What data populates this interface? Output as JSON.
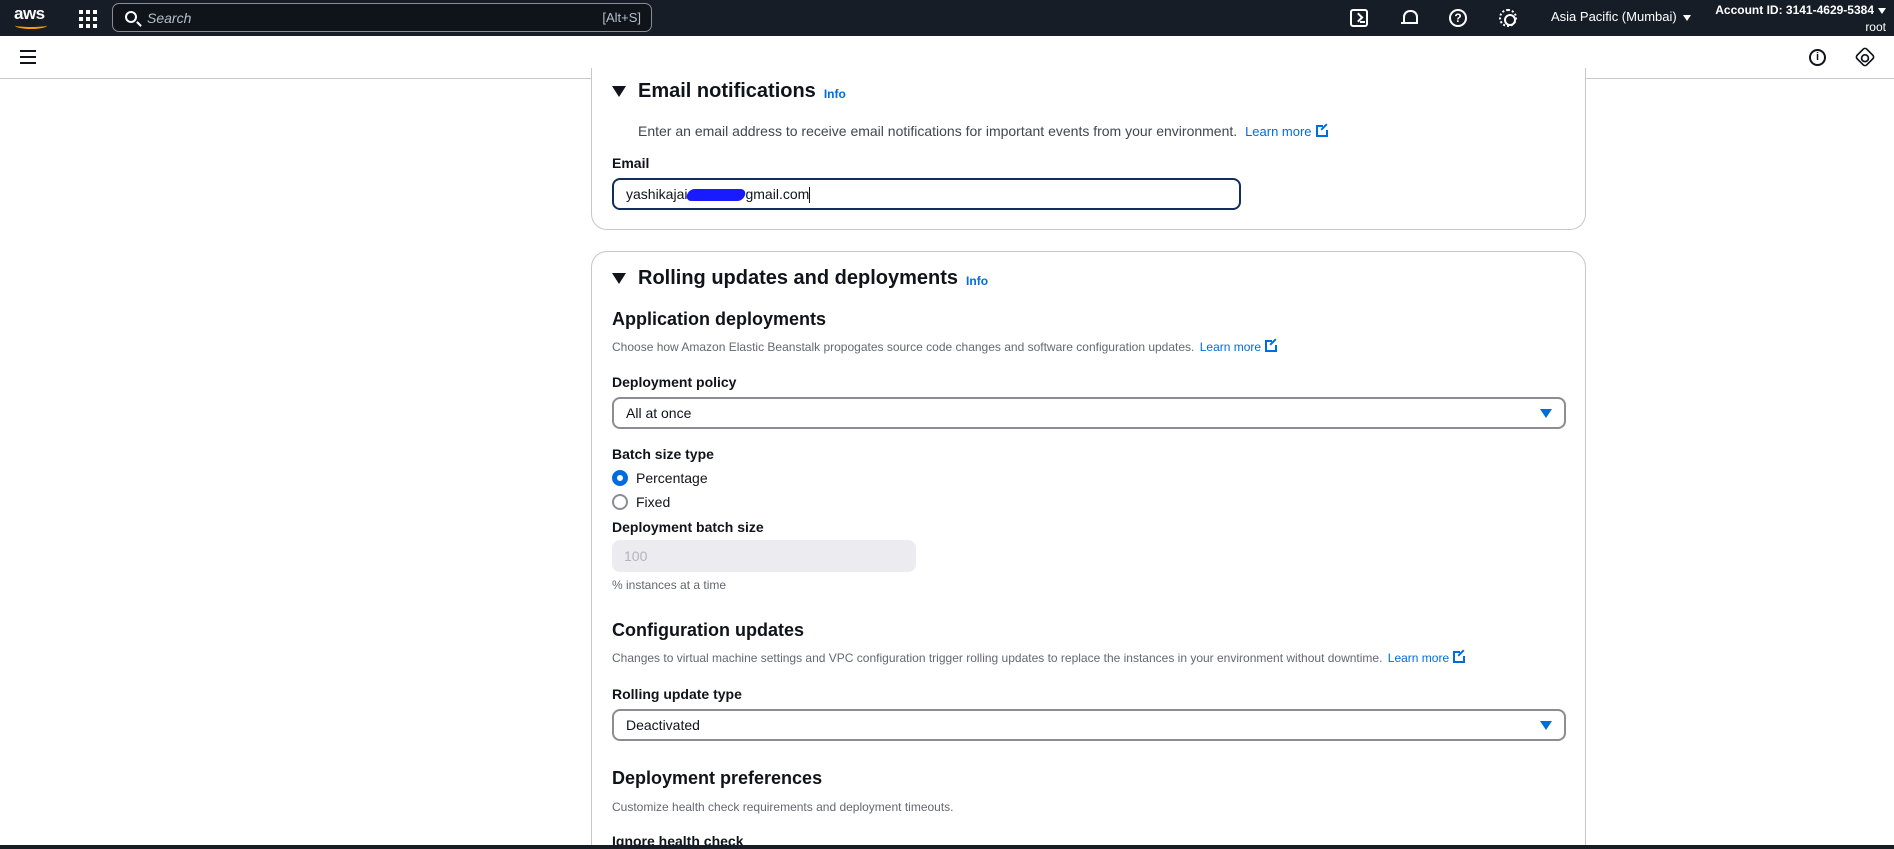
{
  "topnav": {
    "logo_text": "aws",
    "search_placeholder": "Search",
    "search_shortcut": "[Alt+S]",
    "help_glyph": "?",
    "region": "Asia Pacific (Mumbai)",
    "account_id": "Account ID: 3141-4629-5384",
    "account_user": "root"
  },
  "subbar": {
    "info_glyph": "i"
  },
  "email_panel": {
    "title": "Email notifications",
    "info": "Info",
    "description": "Enter an email address to receive email notifications for important events from your environment.",
    "learn_more": "Learn more",
    "email_label": "Email",
    "email_prefix": "yashikajai",
    "email_suffix": "gmail.com"
  },
  "rolling_panel": {
    "title": "Rolling updates and deployments",
    "info": "Info",
    "app_deployments": {
      "title": "Application deployments",
      "description": "Choose how Amazon Elastic Beanstalk propogates source code changes and software configuration updates.",
      "learn_more": "Learn more"
    },
    "deployment_policy": {
      "label": "Deployment policy",
      "value": "All at once"
    },
    "batch_size_type": {
      "label": "Batch size type",
      "options": [
        "Percentage",
        "Fixed"
      ],
      "selected": "Percentage"
    },
    "deployment_batch_size": {
      "label": "Deployment batch size",
      "placeholder": "100",
      "hint": "% instances at a time"
    },
    "config_updates": {
      "title": "Configuration updates",
      "description": "Changes to virtual machine settings and VPC configuration trigger rolling updates to replace the instances in your environment without downtime.",
      "learn_more": "Learn more"
    },
    "rolling_update_type": {
      "label": "Rolling update type",
      "value": "Deactivated"
    },
    "deployment_prefs": {
      "title": "Deployment preferences",
      "description": "Customize health check requirements and deployment timeouts.",
      "ignore_health_label": "Ignore health check"
    }
  },
  "colors": {
    "nav_bg": "#161d26",
    "link": "#006ce0",
    "aws_orange": "#ff9900",
    "border": "#c6c6cd"
  },
  "icons": [
    "aws-logo",
    "apps-grid-icon",
    "search-icon",
    "cloudshell-icon",
    "bell-icon",
    "help-icon",
    "gear-icon",
    "menu-icon",
    "info-icon",
    "hexagon-icon",
    "external-link-icon",
    "caret-down-icon"
  ]
}
